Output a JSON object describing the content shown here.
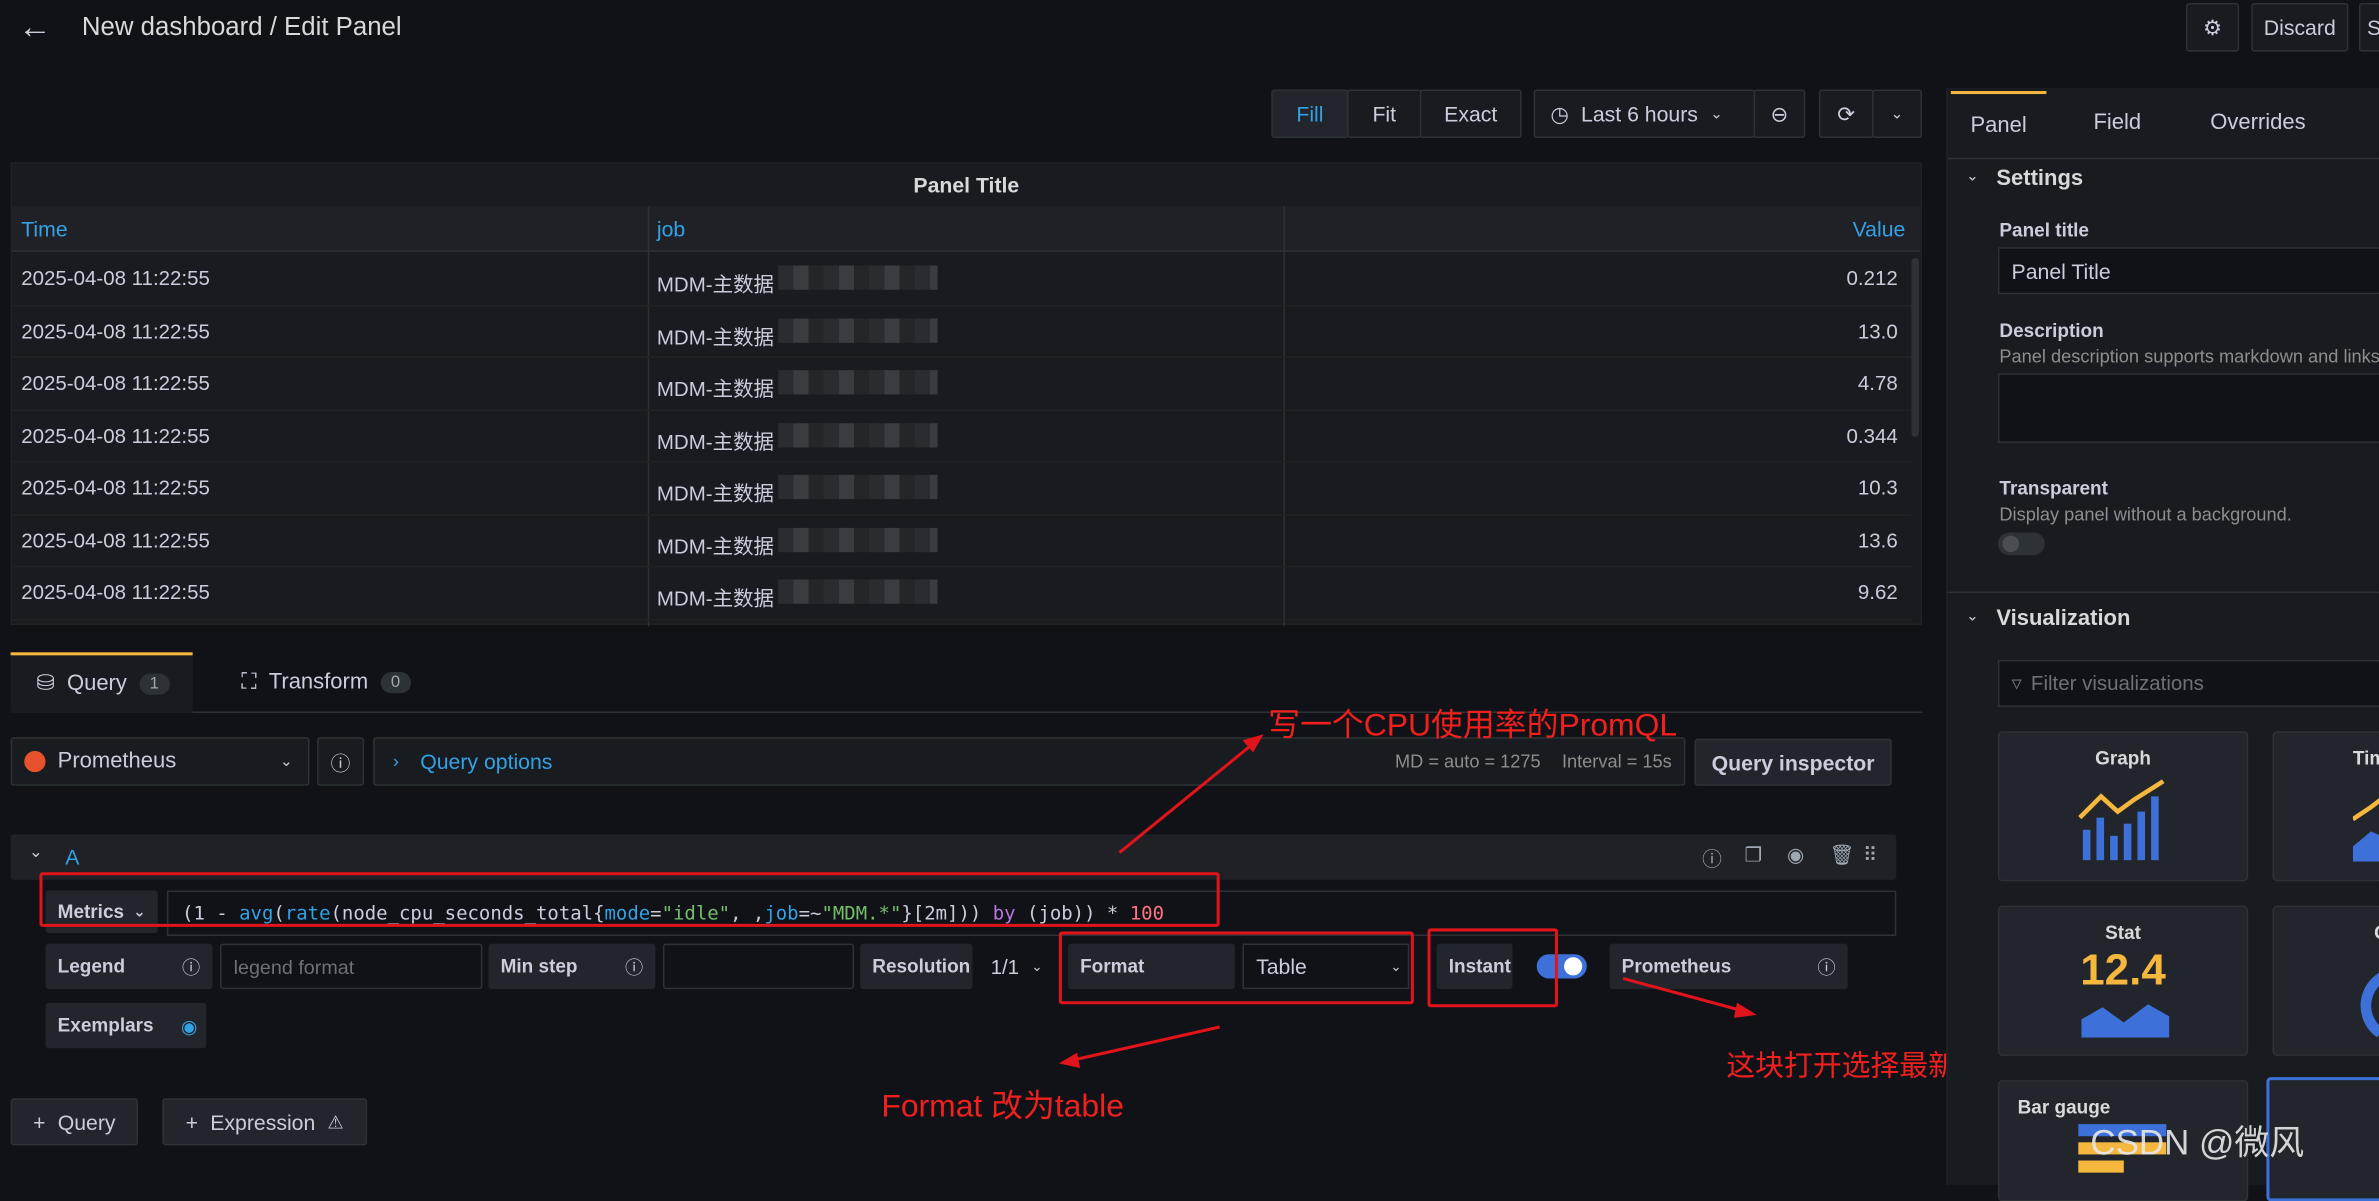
{
  "header": {
    "title": "New dashboard / Edit Panel",
    "discard": "Discard",
    "save_partial": "S"
  },
  "toolbar": {
    "fill": "Fill",
    "fit": "Fit",
    "exact": "Exact",
    "timerange": "Last 6 hours"
  },
  "panel": {
    "title": "Panel Title",
    "columns": [
      "Time",
      "job",
      "Value"
    ],
    "rows": [
      {
        "time": "2025-04-08 11:22:55",
        "job": "MDM-主数据",
        "value": "0.212"
      },
      {
        "time": "2025-04-08 11:22:55",
        "job": "MDM-主数据",
        "value": "13.0"
      },
      {
        "time": "2025-04-08 11:22:55",
        "job": "MDM-主数据",
        "value": "4.78"
      },
      {
        "time": "2025-04-08 11:22:55",
        "job": "MDM-主数据",
        "value": "0.344"
      },
      {
        "time": "2025-04-08 11:22:55",
        "job": "MDM-主数据",
        "value": "10.3"
      },
      {
        "time": "2025-04-08 11:22:55",
        "job": "MDM-主数据",
        "value": "13.6"
      },
      {
        "time": "2025-04-08 11:22:55",
        "job": "MDM-主数据",
        "value": "9.62"
      }
    ]
  },
  "query_tabs": {
    "query": "Query",
    "query_count": "1",
    "transform": "Transform",
    "transform_count": "0"
  },
  "datasource": {
    "name": "Prometheus",
    "query_options": "Query options",
    "md": "MD = auto = 1275",
    "interval": "Interval = 15s",
    "inspector": "Query inspector"
  },
  "query": {
    "ref": "A",
    "metrics_label": "Metrics",
    "expr_parts": {
      "p1": "(1 - ",
      "avg": "avg",
      "p2": "(",
      "rate": "rate",
      "p3": "(node_cpu_seconds_total{",
      "mode": "mode",
      "p4": "=",
      "idle": "\"idle\"",
      "p5": ", ,",
      "job": "job",
      "p6": "=~",
      "mdm": "\"MDM.*\"",
      "p7": "}[2m])) ",
      "by": "by",
      "p8": " (job)) * ",
      "n100": "100"
    },
    "legend": "Legend",
    "legend_placeholder": "legend format",
    "minstep": "Min step",
    "resolution": "Resolution",
    "resolution_value": "1/1",
    "format": "Format",
    "format_value": "Table",
    "instant": "Instant",
    "prom": "Prometheus",
    "exemplars": "Exemplars"
  },
  "add": {
    "query": "Query",
    "expression": "Expression"
  },
  "annotations": {
    "a1": "写一个CPU使用率的PromQL",
    "a2": "Format 改为table",
    "a3": "这块打开选择最新数据"
  },
  "right": {
    "tabs": [
      "Panel",
      "Field",
      "Overrides"
    ],
    "settings": "Settings",
    "panel_title_label": "Panel title",
    "panel_title_value": "Panel Title",
    "description": "Description",
    "description_hint": "Panel description supports markdown and links.",
    "transparent": "Transparent",
    "transparent_hint": "Display panel without a background.",
    "visualization": "Visualization",
    "filter_placeholder": "Filter visualizations",
    "cards": [
      "Graph",
      "Tim",
      "Stat",
      "G",
      "Bar gauge"
    ],
    "stat_value": "12.4"
  },
  "watermark": "CSDN @微风",
  "colors": {
    "accent": "#33a2e5",
    "annotation": "#e0141a"
  }
}
